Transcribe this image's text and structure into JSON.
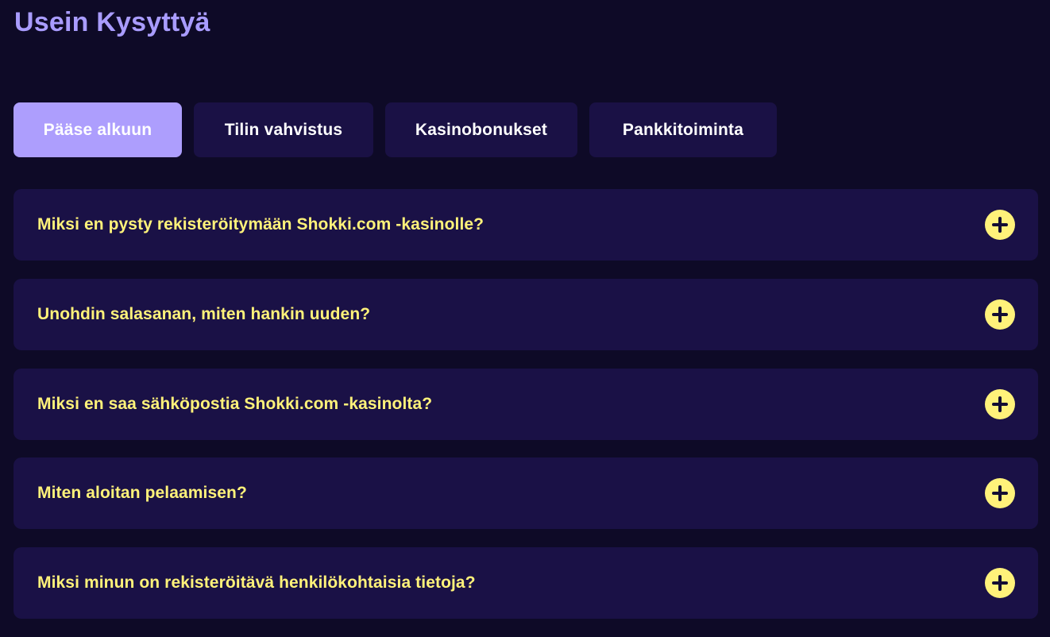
{
  "page": {
    "title": "Usein Kysyttyä"
  },
  "tabs": [
    {
      "label": "Pääse alkuun",
      "active": true
    },
    {
      "label": "Tilin vahvistus",
      "active": false
    },
    {
      "label": "Kasinobonukset",
      "active": false
    },
    {
      "label": "Pankkitoiminta",
      "active": false
    }
  ],
  "faq": {
    "items": [
      {
        "question": "Miksi en pysty rekisteröitymään Shokki.com -kasinolle?",
        "icon": "plus-icon"
      },
      {
        "question": "Unohdin salasanan, miten hankin uuden?",
        "icon": "plus-icon"
      },
      {
        "question": "Miksi en saa sähköpostia Shokki.com -kasinolta?",
        "icon": "plus-icon"
      },
      {
        "question": "Miten aloitan pelaamisen?",
        "icon": "plus-icon"
      },
      {
        "question": "Miksi minun on rekisteröitävä henkilökohtaisia tietoja?",
        "icon": "plus-icon"
      }
    ]
  },
  "colors": {
    "background": "#0e0a27",
    "card": "#1a1146",
    "accent_purple": "#ad9efd",
    "accent_yellow": "#fff27a"
  }
}
